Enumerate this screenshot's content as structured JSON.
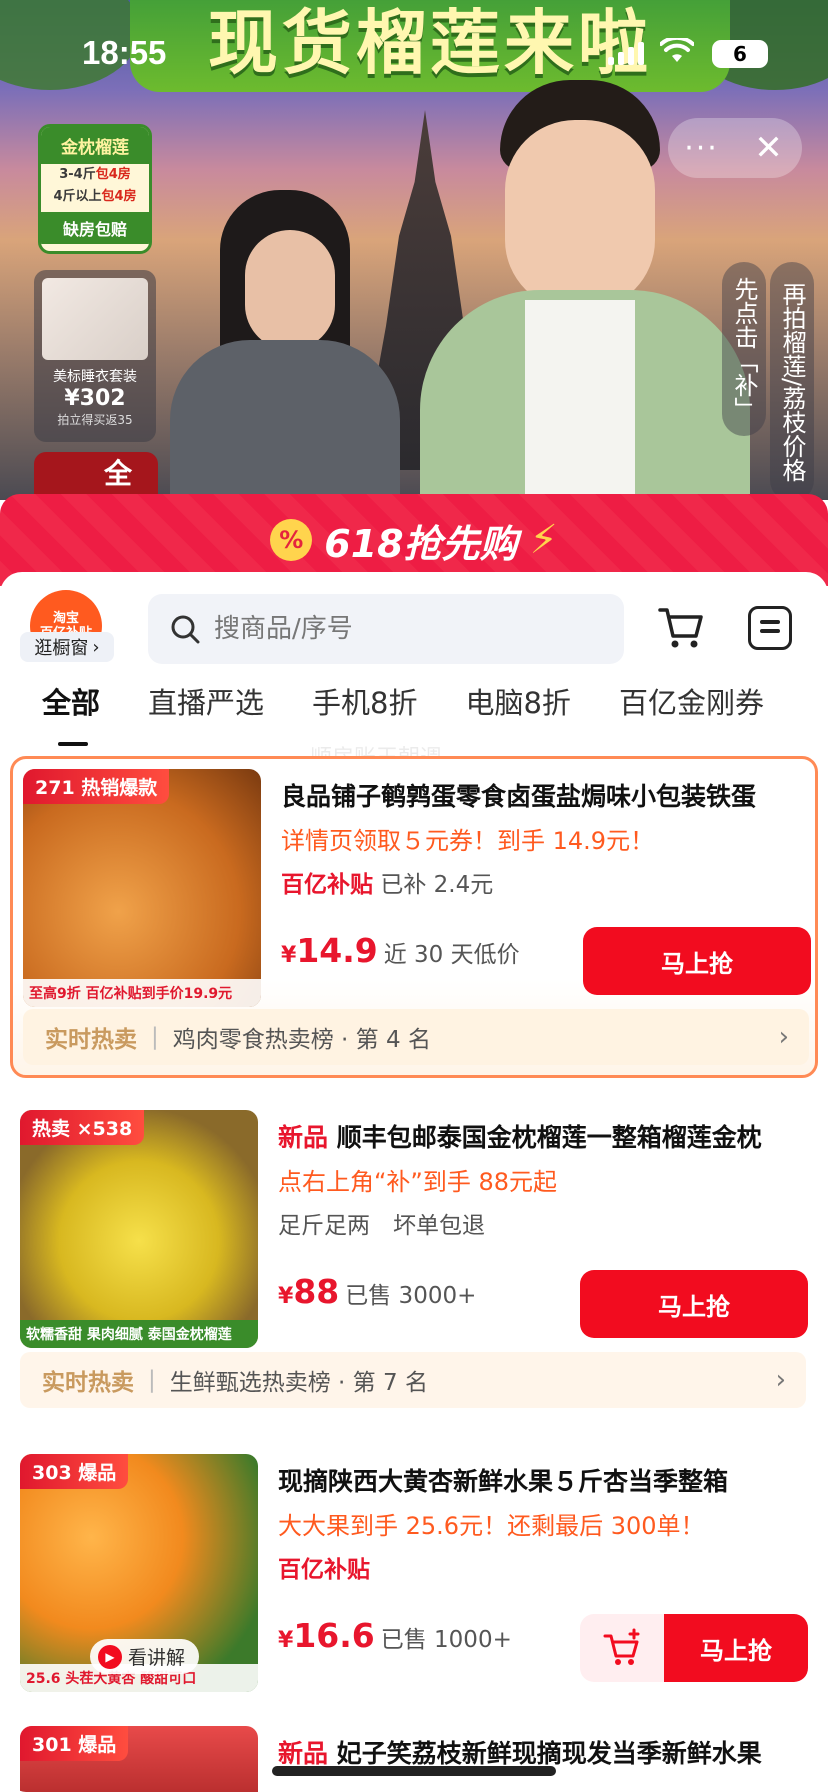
{
  "status": {
    "time": "18:55",
    "battery": "6"
  },
  "stream": {
    "banner": "现货榴莲来啦",
    "gold_card": {
      "title": "金枕榴莲",
      "line1_pre": "3-4斤",
      "line1_em": "包4房",
      "line2_pre": "4斤以上",
      "line2_em": "包4房",
      "footer": "缺房包赔"
    },
    "pajama_card": {
      "name": "美标睡衣套装",
      "price": "¥302",
      "note": "拍立得买返35"
    },
    "red_card": "全程",
    "vertical_notes": [
      "先点击「补」",
      "再拍榴莲/荔枝价格"
    ],
    "more_label": "···",
    "close_label": "✕"
  },
  "promo": {
    "badge": "%",
    "title": "618抢先购",
    "bolt": "⚡"
  },
  "header": {
    "logo_text": "淘宝\n百亿补贴",
    "window_link": "逛橱窗",
    "search_placeholder": "搜商品/序号"
  },
  "tabs": [
    "全部",
    "直播严选",
    "手机8折",
    "电脑8折",
    "百亿金刚券"
  ],
  "watermark": "顺房账王朝週",
  "products": [
    {
      "thumb_tag": "271 热销爆款",
      "thumb_sub": "至高9折 百亿补贴到手价19.9元",
      "title": "良品铺子鹌鹑蛋零食卤蛋盐焗味小包装铁蛋",
      "promo": "详情页领取５元券！到手 14.9元！",
      "subsidy": "百亿补贴",
      "subsidy_note": "已补 2.4元",
      "price": "14.9",
      "price_note": "近 30 天低价",
      "buy": "马上抢",
      "rank_hot": "实时热卖",
      "rank_text": "鸡肉零食热卖榜 · 第 4 名"
    },
    {
      "thumb_tag": "热卖 ×538",
      "thumb_sub": "软糯香甜 果肉细腻 泰国金枕榴莲",
      "badge": "新品",
      "title": "顺丰包邮泰国金枕榴莲一整箱榴莲金枕",
      "promo": "点右上角“补”到手 88元起",
      "line3": "足斤足两　坏单包退",
      "price": "88",
      "price_note": "已售 3000+",
      "buy": "马上抢",
      "rank_hot": "实时热卖",
      "rank_text": "生鲜甄选热卖榜 · 第 7 名"
    },
    {
      "thumb_tag": "303 爆品",
      "thumb_sub": "25.6 头茬大黄杏 酸甜可口",
      "lecture": "看讲解",
      "title": "现摘陕西大黄杏新鲜水果５斤杏当季整箱",
      "promo": "大大果到手 25.6元！还剩最后 300单！",
      "subsidy": "百亿补贴",
      "price": "16.6",
      "price_note": "已售 1000+",
      "buy": "马上抢"
    },
    {
      "thumb_tag": "301 爆品",
      "badge": "新品",
      "title": "妃子笑荔枝新鲜现摘现发当季新鲜水果"
    }
  ],
  "colors": {
    "brand_red": "#f20c1f",
    "orange": "#ff5a1f",
    "green": "#3a8c2a"
  }
}
